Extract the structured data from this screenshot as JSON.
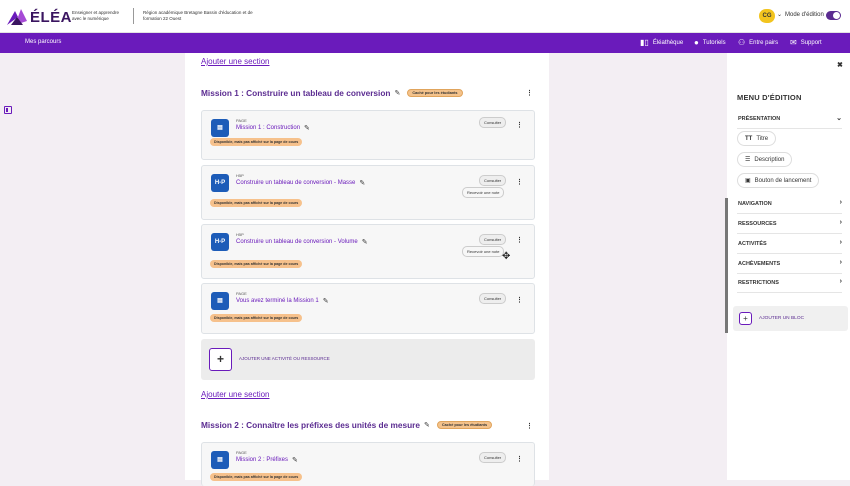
{
  "header": {
    "logo_text": "ÉLÉA",
    "tagline": "Enseigner et apprendre avec le numérique",
    "region": "Région académique Bretagne Bassin d'éducation et de formation 22 Ouest",
    "user_initials": "CG",
    "edit_mode_label": "Mode d'édition"
  },
  "navbar": {
    "left": "Mes parcours",
    "items": [
      "Éléathèque",
      "Tutoriels",
      "Entre pairs",
      "Support"
    ]
  },
  "course": {
    "add_section_label": "Ajouter une section",
    "hidden_badge": "Caché pour les étudiants",
    "available_badge": "Disponible, mais pas affiché sur la page de cours",
    "consult_label": "Consulter",
    "note_label": "Recevoir une note",
    "add_activity_label": "AJOUTER UNE ACTIVITÉ OU RESSOURCE",
    "sections": [
      {
        "title": "Mission 1 : Construire un tableau de conversion"
      },
      {
        "title": "Mission 2 : Connaître les préfixes des unités de mesure"
      }
    ],
    "activities": [
      {
        "type": "PAGE",
        "name": "Mission 1 : Construction",
        "icon": "page-icon"
      },
      {
        "type": "H5P",
        "name": "Construire un tableau de conversion - Masse",
        "icon": "h5p-icon"
      },
      {
        "type": "H5P",
        "name": "Construire un tableau de conversion - Volume",
        "icon": "h5p-icon"
      },
      {
        "type": "PAGE",
        "name": "Vous avez terminé la Mission 1",
        "icon": "page-icon"
      },
      {
        "type": "PAGE",
        "name": "Mission 2 : Préfixes",
        "icon": "page-icon"
      }
    ]
  },
  "drawer": {
    "title": "MENU D'ÉDITION",
    "presentation": "PRÉSENTATION",
    "pills": [
      "Titre",
      "Description",
      "Bouton de lancement"
    ],
    "rows": [
      "NAVIGATION",
      "RESSOURCES",
      "ACTIVITÉS",
      "ACHÈVEMENTS",
      "RESTRICTIONS"
    ],
    "add_block": "AJOUTER UN BLOC"
  },
  "colors": {
    "brand": "#6a1bbb",
    "badge": "#f4c28b",
    "icon_blue": "#1d5cb8"
  }
}
